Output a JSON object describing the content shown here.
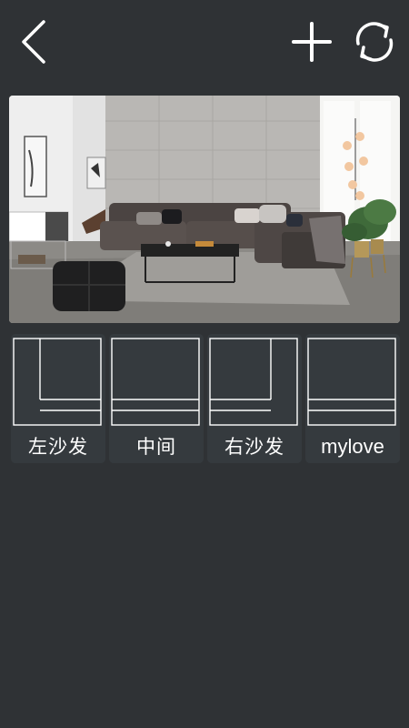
{
  "header": {
    "back_icon": "chevron-left-icon",
    "add_icon": "plus-icon",
    "refresh_icon": "refresh-icon"
  },
  "preview": {
    "description_icon": "room-photo"
  },
  "options": [
    {
      "label": "左沙发",
      "layout": "left"
    },
    {
      "label": "中间",
      "layout": "middle"
    },
    {
      "label": "右沙发",
      "layout": "right"
    },
    {
      "label": "mylove",
      "layout": "middle"
    }
  ],
  "colors": {
    "background": "#2f3235",
    "card": "#353a3e",
    "line": "#ffffff"
  }
}
